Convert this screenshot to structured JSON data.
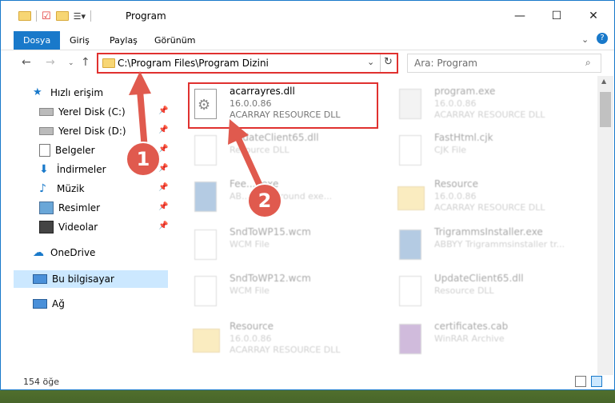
{
  "window": {
    "title": "Program",
    "controls": {
      "minimize": "—",
      "maximize": "☐",
      "close": "✕"
    }
  },
  "ribbon": {
    "tabs": [
      "Dosya",
      "Giriş",
      "Paylaş",
      "Görünüm"
    ]
  },
  "address": {
    "path": "C:\\Program Files\\Program Dizini",
    "search_placeholder": "Ara: Program"
  },
  "sidebar": {
    "items": [
      {
        "label": "Hızlı erişim",
        "icon": "star-icon"
      },
      {
        "label": "Yerel Disk (C:)",
        "icon": "drive-icon"
      },
      {
        "label": "Yerel Disk (D:)",
        "icon": "drive-icon"
      },
      {
        "label": "Belgeler",
        "icon": "document-icon"
      },
      {
        "label": "İndirmeler",
        "icon": "download-icon"
      },
      {
        "label": "Müzik",
        "icon": "music-icon"
      },
      {
        "label": "Resimler",
        "icon": "pictures-icon"
      },
      {
        "label": "Videolar",
        "icon": "video-icon"
      },
      {
        "label": "OneDrive",
        "icon": "cloud-icon"
      },
      {
        "label": "Bu bilgisayar",
        "icon": "computer-icon"
      },
      {
        "label": "Ağ",
        "icon": "network-icon"
      }
    ]
  },
  "files": [
    {
      "name": "acarrayres.dll",
      "version": "16.0.0.86",
      "desc": "ACARRAY RESOURCE DLL"
    },
    {
      "name": "program.exe",
      "version": "16.0.0.86",
      "desc": "ACARRAY RESOURCE DLL"
    },
    {
      "name": "UpdateClient65.dll",
      "version": "",
      "desc": "Resource DLL"
    },
    {
      "name": "FastHtml.cjk",
      "version": "",
      "desc": "CJK File"
    },
    {
      "name": "Fee... .exe",
      "version": "",
      "desc": "AB... Background exe..."
    },
    {
      "name": "Resource",
      "version": "16.0.0.86",
      "desc": "ACARRAY RESOURCE DLL"
    },
    {
      "name": "SndToWP15.wcm",
      "version": "",
      "desc": "WCM File"
    },
    {
      "name": "TrigrammsInstaller.exe",
      "version": "",
      "desc": "ABBYY Trigrammsinstaller tr..."
    },
    {
      "name": "SndToWP12.wcm",
      "version": "",
      "desc": "WCM File"
    },
    {
      "name": "UpdateClient65.dll",
      "version": "",
      "desc": "Resource DLL"
    },
    {
      "name": "Resource",
      "version": "16.0.0.86",
      "desc": "ACARRAY RESOURCE DLL"
    },
    {
      "name": "certificates.cab",
      "version": "",
      "desc": "WinRAR Archive"
    }
  ],
  "status": {
    "count": "154 öğe"
  },
  "annotations": {
    "step1": "1",
    "step2": "2"
  },
  "colors": {
    "accent": "#1979ca",
    "highlight": "#e0312f",
    "selection": "#cce8ff"
  }
}
